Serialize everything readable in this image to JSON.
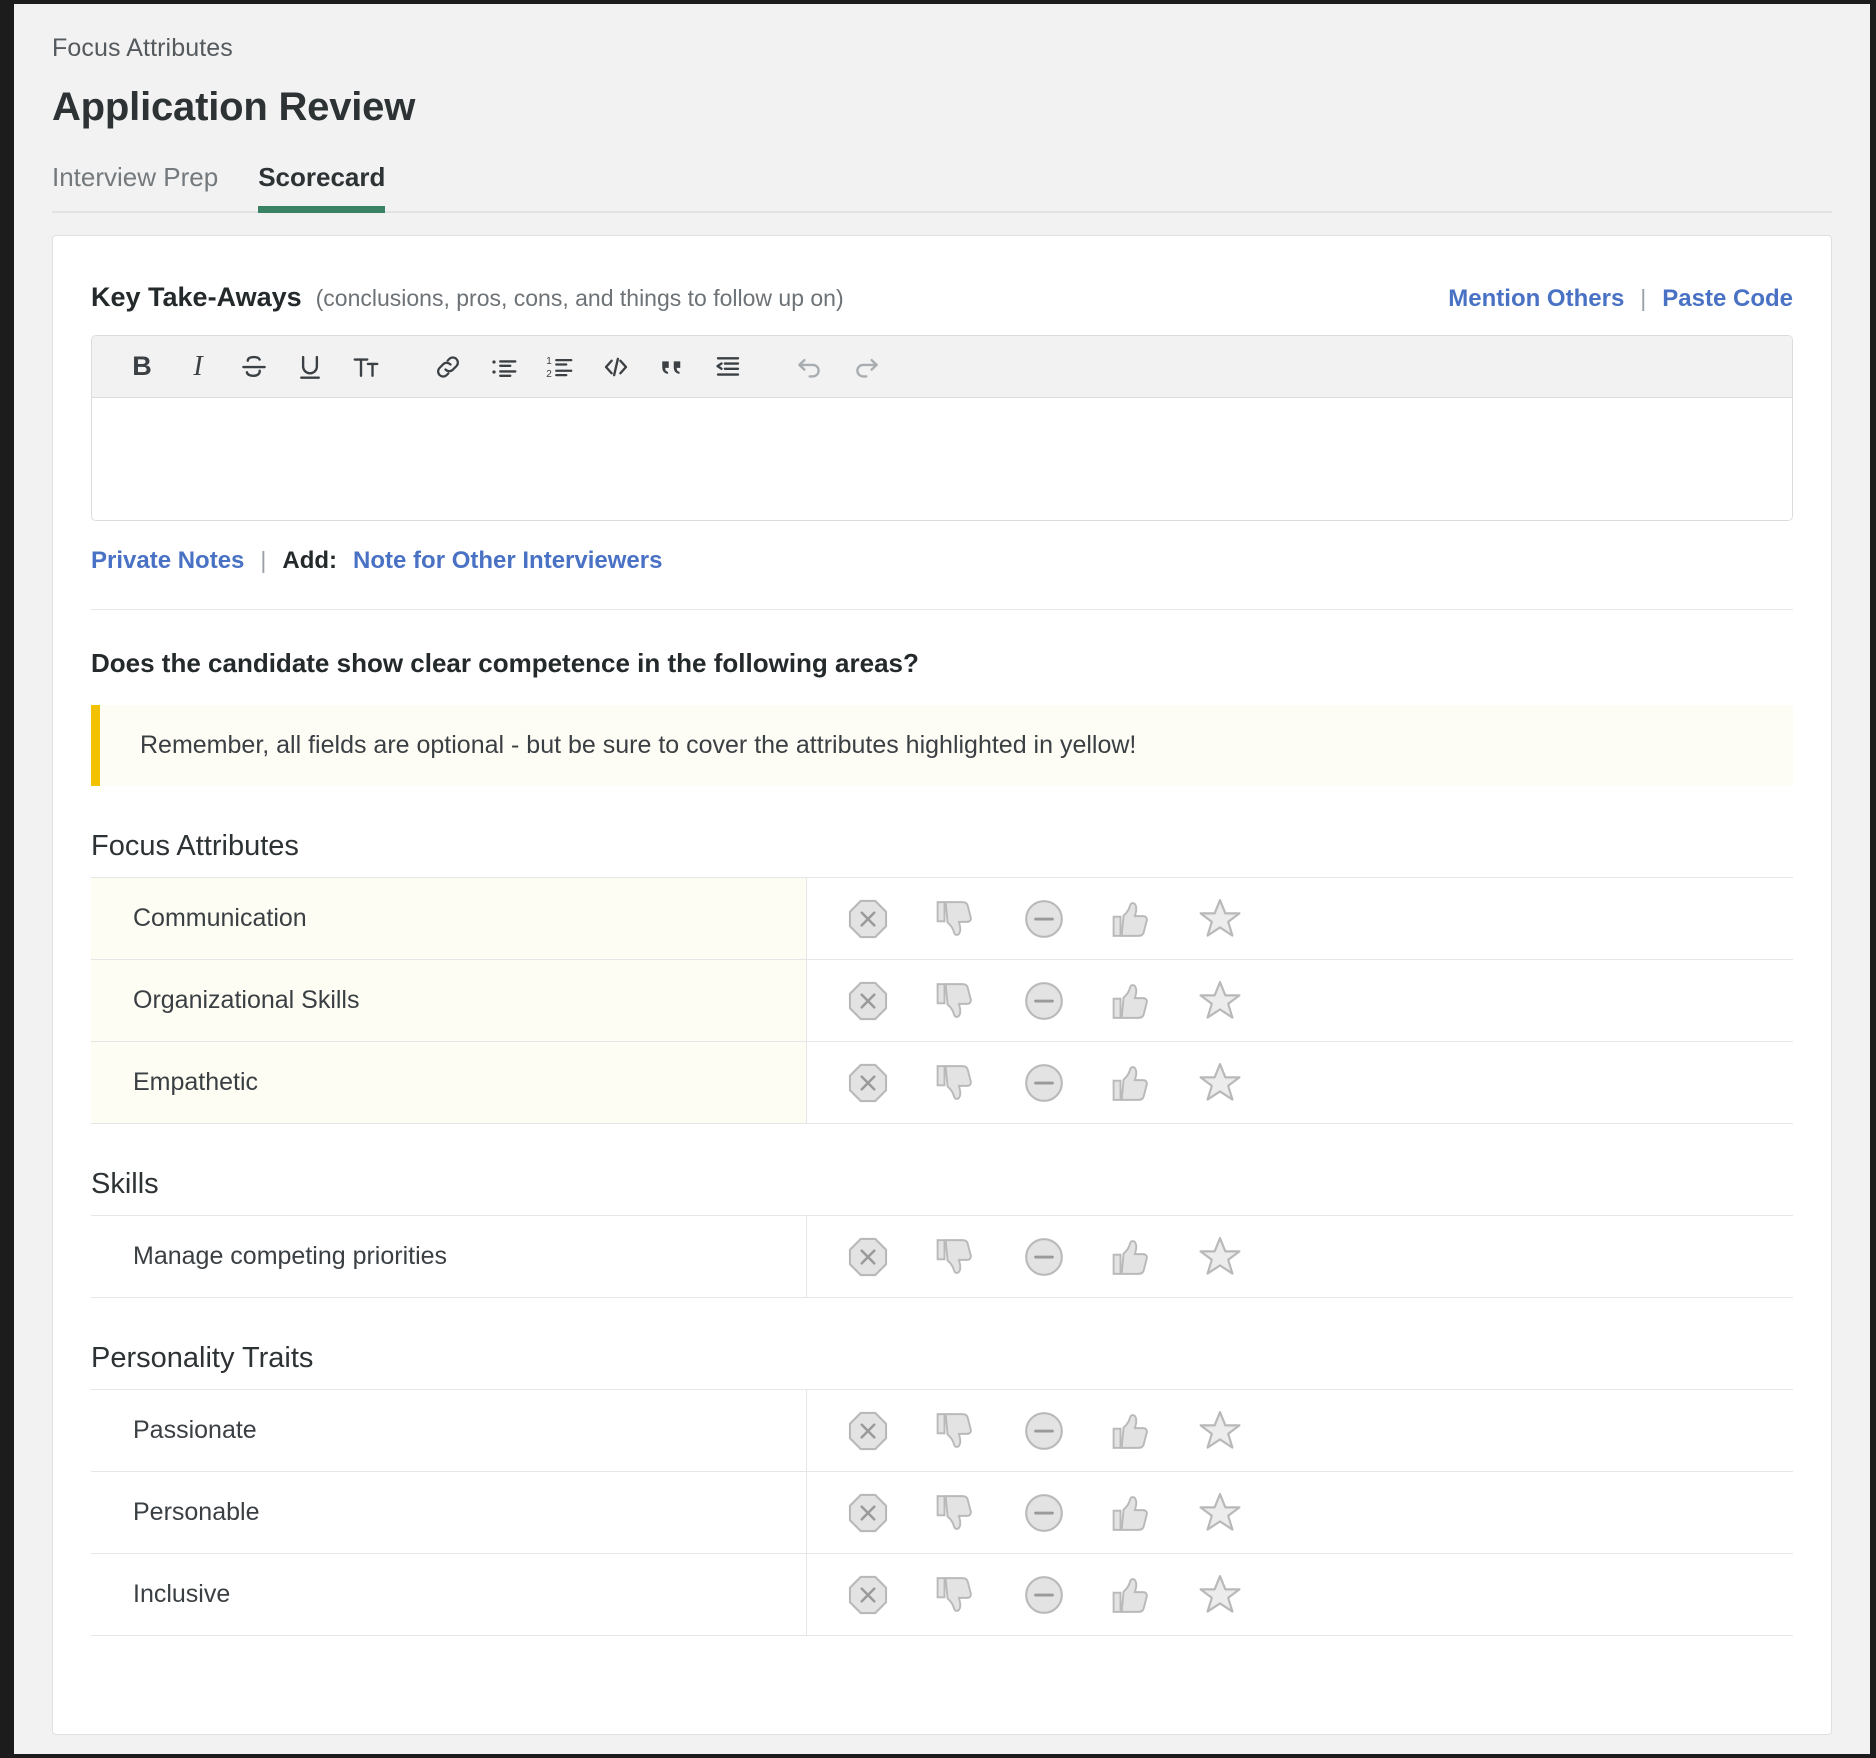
{
  "header": {
    "breadcrumb": "Focus Attributes",
    "title": "Application Review",
    "tabs": [
      {
        "label": "Interview Prep",
        "active": false
      },
      {
        "label": "Scorecard",
        "active": true
      }
    ],
    "active_tab_color": "#3a8264"
  },
  "key_takeaways": {
    "title": "Key Take-Aways",
    "subtitle": "(conclusions, pros, cons, and things to follow up on)",
    "mention_others": "Mention Others",
    "separator": "|",
    "paste_code": "Paste Code",
    "link_color": "#4a72c4",
    "editor_value": "",
    "toolbar": [
      {
        "name": "bold-icon",
        "label": "B"
      },
      {
        "name": "italic-icon",
        "label": "I"
      },
      {
        "name": "strikethrough-icon",
        "label": "S"
      },
      {
        "name": "underline-icon",
        "label": "U"
      },
      {
        "name": "text-size-icon",
        "label": "TT"
      },
      {
        "name": "link-icon",
        "label": "link"
      },
      {
        "name": "bulleted-list-icon",
        "label": "bullets"
      },
      {
        "name": "numbered-list-icon",
        "label": "numbers"
      },
      {
        "name": "code-icon",
        "label": "</>"
      },
      {
        "name": "blockquote-icon",
        "label": "quote"
      },
      {
        "name": "indent-icon",
        "label": "indent"
      },
      {
        "name": "undo-icon",
        "label": "undo"
      },
      {
        "name": "redo-icon",
        "label": "redo"
      }
    ]
  },
  "notes": {
    "private_notes": "Private Notes",
    "separator": "|",
    "add_label": "Add:",
    "note_for_others": "Note for Other Interviewers"
  },
  "assessment": {
    "question": "Does the candidate show clear competence in the following areas?",
    "notice": "Remember, all fields are optional - but be sure to cover the attributes highlighted in yellow!",
    "notice_accent_color": "#f2c200",
    "notice_background": "#fefdf5",
    "highlight_background": "#fefdf3",
    "rating_options": [
      {
        "name": "strong-no-icon",
        "label": "Strong No"
      },
      {
        "name": "thumbs-down-icon",
        "label": "No"
      },
      {
        "name": "mixed-icon",
        "label": "Mixed"
      },
      {
        "name": "thumbs-up-icon",
        "label": "Yes"
      },
      {
        "name": "strong-yes-star-icon",
        "label": "Strong Yes"
      }
    ],
    "groups": [
      {
        "title": "Focus Attributes",
        "highlighted": true,
        "attributes": [
          {
            "label": "Communication"
          },
          {
            "label": "Organizational Skills"
          },
          {
            "label": "Empathetic"
          }
        ]
      },
      {
        "title": "Skills",
        "highlighted": false,
        "attributes": [
          {
            "label": "Manage competing priorities"
          }
        ]
      },
      {
        "title": "Personality Traits",
        "highlighted": false,
        "attributes": [
          {
            "label": "Passionate"
          },
          {
            "label": "Personable"
          },
          {
            "label": "Inclusive"
          }
        ]
      }
    ]
  }
}
